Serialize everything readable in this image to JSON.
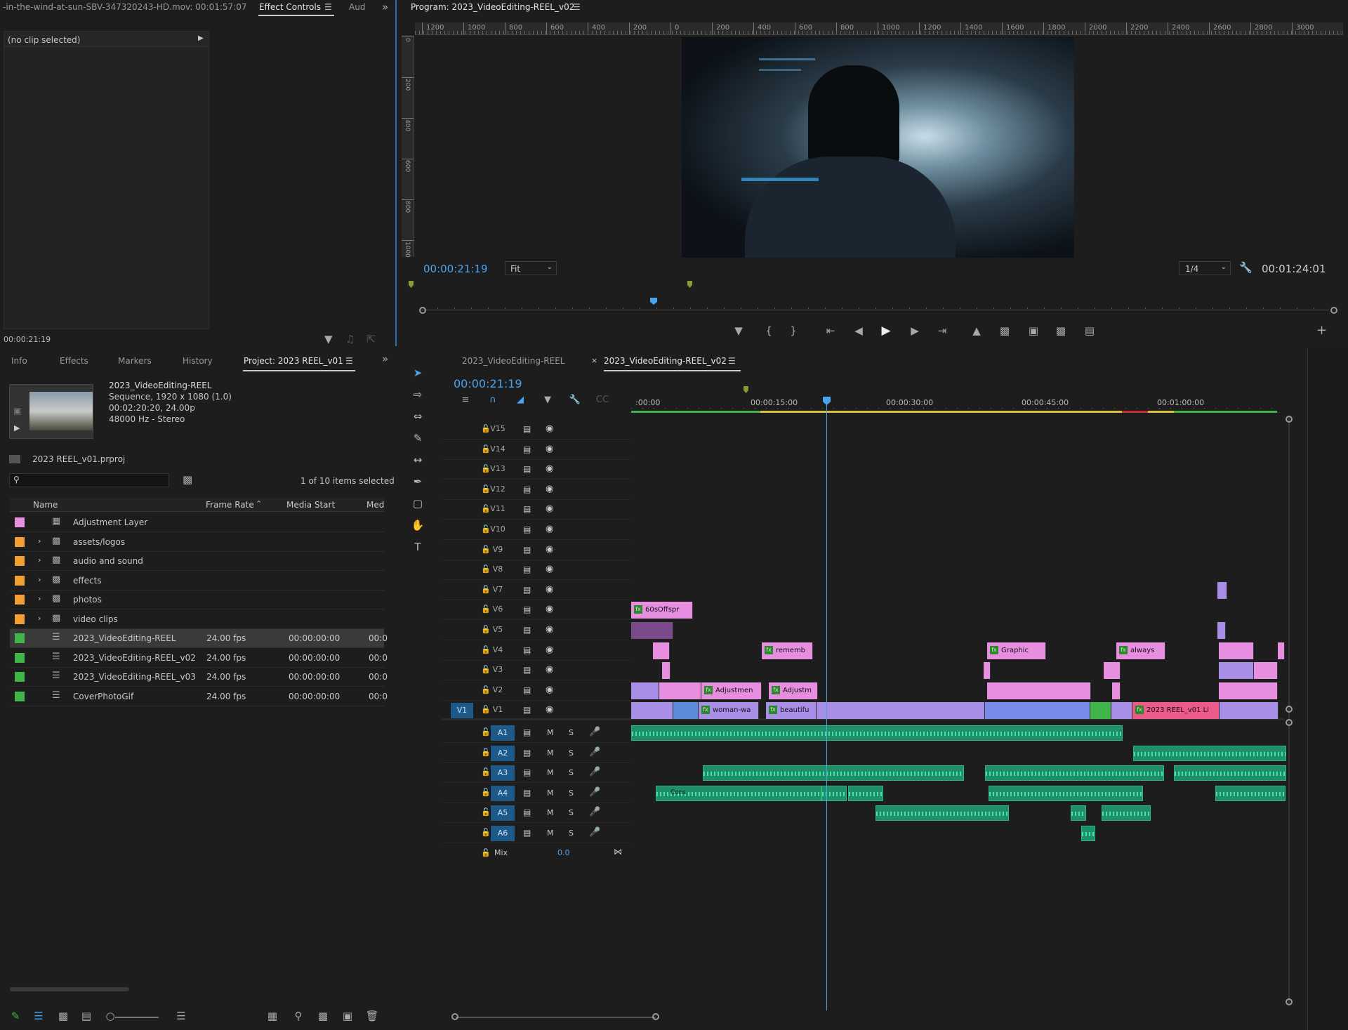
{
  "source_panel": {
    "clip_title": "-in-the-wind-at-sun-SBV-347320243-HD.mov: 00:01:57:07",
    "tab_effect_controls": "Effect Controls",
    "tab_audio": "Aud",
    "no_clip": "(no clip selected)",
    "timecode": "00:00:21:19"
  },
  "program": {
    "title": "Program: 2023_VideoEditing-REEL_v02",
    "timecode": "00:00:21:19",
    "fit": "Fit",
    "resolution": "1/4",
    "duration": "00:01:24:01",
    "ruler_h": [
      "1200",
      "1000",
      "800",
      "600",
      "400",
      "200",
      "0",
      "200",
      "400",
      "600",
      "800",
      "1000",
      "1200",
      "1400",
      "1600",
      "1800",
      "2000",
      "2200",
      "2400",
      "2600",
      "2800",
      "3000"
    ],
    "ruler_v": [
      "0",
      "200",
      "400",
      "600",
      "800",
      "1000"
    ]
  },
  "project": {
    "tabs": [
      "Info",
      "Effects",
      "Markers",
      "History",
      "Project: 2023 REEL_v01"
    ],
    "seq_name": "2023_VideoEditing-REEL",
    "seq_line1": "Sequence, 1920 x 1080 (1.0)",
    "seq_line2": "00:02:20:20, 24.00p",
    "seq_line3": "48000 Hz - Stereo",
    "proj_file": "2023 REEL_v01.prproj",
    "selection": "1 of 10 items selected",
    "columns": [
      "Name",
      "Frame Rate",
      "Media Start",
      "Med"
    ],
    "items": [
      {
        "name": "Adjustment Layer",
        "fps": "",
        "start": "",
        "med": "",
        "color": "#e88ee0"
      },
      {
        "name": "assets/logos",
        "fps": "",
        "start": "",
        "med": "",
        "color": "#f0a030"
      },
      {
        "name": "audio and sound",
        "fps": "",
        "start": "",
        "med": "",
        "color": "#f0a030"
      },
      {
        "name": "effects",
        "fps": "",
        "start": "",
        "med": "",
        "color": "#f0a030"
      },
      {
        "name": "photos",
        "fps": "",
        "start": "",
        "med": "",
        "color": "#f0a030"
      },
      {
        "name": "video clips",
        "fps": "",
        "start": "",
        "med": "",
        "color": "#f0a030"
      },
      {
        "name": "2023_VideoEditing-REEL",
        "fps": "24.00 fps",
        "start": "00:00:00:00",
        "med": "00:0",
        "color": "#3fb54a"
      },
      {
        "name": "2023_VideoEditing-REEL_v02",
        "fps": "24.00 fps",
        "start": "00:00:00:00",
        "med": "00:0",
        "color": "#3fb54a"
      },
      {
        "name": "2023_VideoEditing-REEL_v03",
        "fps": "24.00 fps",
        "start": "00:00:00:00",
        "med": "00:0",
        "color": "#3fb54a"
      },
      {
        "name": "CoverPhotoGif",
        "fps": "24.00 fps",
        "start": "00:00:00:00",
        "med": "00:0",
        "color": "#3fb54a"
      }
    ]
  },
  "timeline": {
    "tabs": [
      "2023_VideoEditing-REEL",
      "2023_VideoEditing-REEL_v02"
    ],
    "timecode": "00:00:21:19",
    "ruler": [
      ":00:00",
      "00:00:15:00",
      "00:00:30:00",
      "00:00:45:00",
      "00:01:00:00"
    ],
    "video_tracks": [
      "V15",
      "V14",
      "V13",
      "V12",
      "V11",
      "V10",
      "V9",
      "V8",
      "V7",
      "V6",
      "V5",
      "V4",
      "V3",
      "V2",
      "V1"
    ],
    "source_patch": "V1",
    "audio_tracks": [
      "A1",
      "A2",
      "A3",
      "A4",
      "A5",
      "A6"
    ],
    "mute": "M",
    "solo": "S",
    "mix_label": "Mix",
    "mix_value": "0.0",
    "clip_labels": {
      "c1": "60sOffspr",
      "c2": "rememb",
      "c3": "Graphic",
      "c4": "always",
      "c5": "Adjustmen",
      "c6": "Adjustm",
      "c7": "woman-wa",
      "c8": "beautifu",
      "c9": "2023 REEL_v01 Li",
      "c10": "Cons"
    }
  },
  "colors": {
    "accent": "#4aa3f0",
    "adjustment": "#e88ee0",
    "video": "#a98ee8",
    "audio": "#2fb584",
    "marker": "#8a9a30"
  }
}
